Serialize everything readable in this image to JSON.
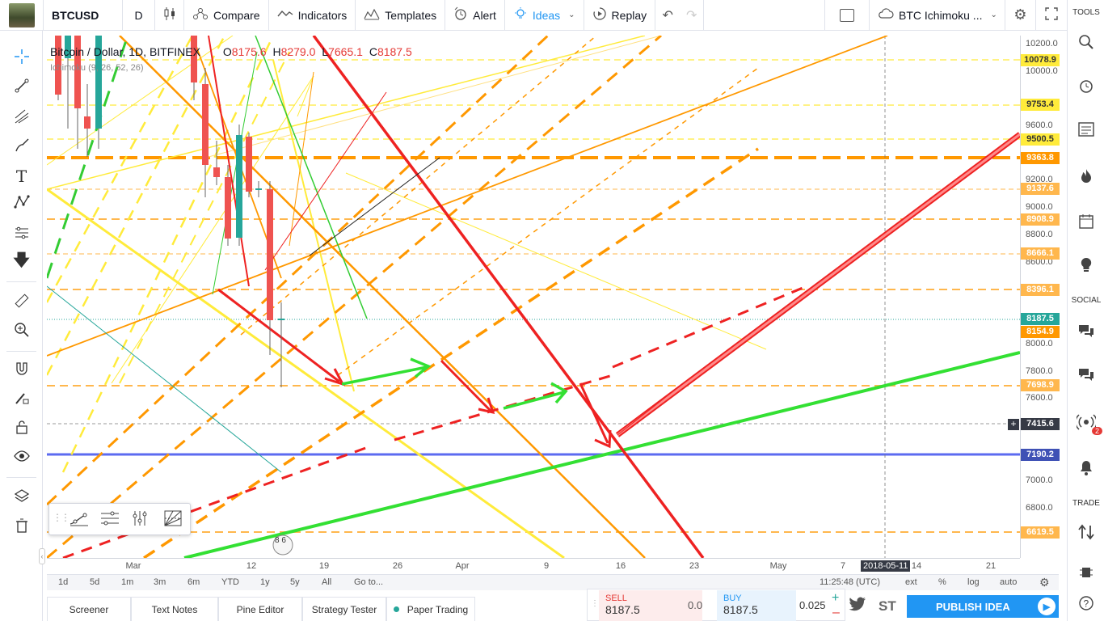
{
  "topbar": {
    "symbol": "BTCUSD",
    "interval": "D",
    "compare": "Compare",
    "indicators": "Indicators",
    "templates": "Templates",
    "alert": "Alert",
    "ideas": "Ideas",
    "replay": "Replay",
    "layout_name": "BTC Ichimoku ..."
  },
  "legend": {
    "title": "Bitcoin / Dollar, 1D, BITFINEX",
    "o_label": "O",
    "o": "8175.6",
    "h_label": "H",
    "h": "8279.0",
    "l_label": "L",
    "l": "7665.1",
    "c_label": "C",
    "c": "8187.5",
    "indicator": "Ichimoku (9, 26, 52, 26)"
  },
  "price_axis": {
    "labels": [
      "10200.0",
      "10000.0",
      "9600.0",
      "9200.0",
      "9000.0",
      "8800.0",
      "8600.0",
      "8000.0",
      "7800.0",
      "7600.0",
      "7000.0",
      "6800.0"
    ],
    "levels": [
      {
        "value": "10078.9",
        "bg": "#ffeb3b",
        "fg": "#333333"
      },
      {
        "value": "9753.4",
        "bg": "#ffeb3b",
        "fg": "#333333"
      },
      {
        "value": "9500.5",
        "bg": "#ffeb3b",
        "fg": "#333333"
      },
      {
        "value": "9363.8",
        "bg": "#ff9800",
        "fg": "#ffffff"
      },
      {
        "value": "9137.6",
        "bg": "#ffb74d",
        "fg": "#ffffff"
      },
      {
        "value": "8908.9",
        "bg": "#ffb74d",
        "fg": "#ffffff"
      },
      {
        "value": "8666.1",
        "bg": "#ffb74d",
        "fg": "#ffffff"
      },
      {
        "value": "8396.1",
        "bg": "#ffb74d",
        "fg": "#ffffff"
      },
      {
        "value": "8187.5",
        "bg": "#26a69a",
        "fg": "#ffffff"
      },
      {
        "value": "8154.9",
        "bg": "#ff9800",
        "fg": "#ffffff"
      },
      {
        "value": "7698.9",
        "bg": "#ffb74d",
        "fg": "#ffffff"
      },
      {
        "value": "7415.6",
        "bg": "#363a45",
        "fg": "#ffffff"
      },
      {
        "value": "7190.2",
        "bg": "#3f51b5",
        "fg": "#ffffff"
      },
      {
        "value": "6619.5",
        "bg": "#ffb74d",
        "fg": "#ffffff"
      }
    ]
  },
  "time_axis": {
    "labels": [
      "Mar",
      "12",
      "19",
      "26",
      "Apr",
      "9",
      "16",
      "23",
      "May",
      "7",
      "14",
      "21"
    ],
    "cursor": "2018-05-11"
  },
  "rangebar": {
    "ranges": [
      "1d",
      "5d",
      "1m",
      "3m",
      "6m",
      "YTD",
      "1y",
      "5y",
      "All"
    ],
    "goto": "Go to...",
    "clock": "11:25:48 (UTC)",
    "ext": "ext",
    "pct": "%",
    "log": "log",
    "auto": "auto"
  },
  "bottom_tabs": [
    "Screener",
    "Text Notes",
    "Pine Editor",
    "Strategy Tester",
    "Paper Trading"
  ],
  "trade": {
    "sell_label": "SELL",
    "sell_price": "8187.5",
    "buy_label": "BUY",
    "buy_price": "8187.5",
    "spread": "0.0",
    "qty": "0.025"
  },
  "right_sidebar": {
    "tools_label": "TOOLS",
    "social_label": "SOCIAL",
    "trade_label": "TRADE",
    "notif_count": "2"
  },
  "publish": "PUBLISH IDEA",
  "st_label": "ST",
  "chart_annotation": "8 6"
}
